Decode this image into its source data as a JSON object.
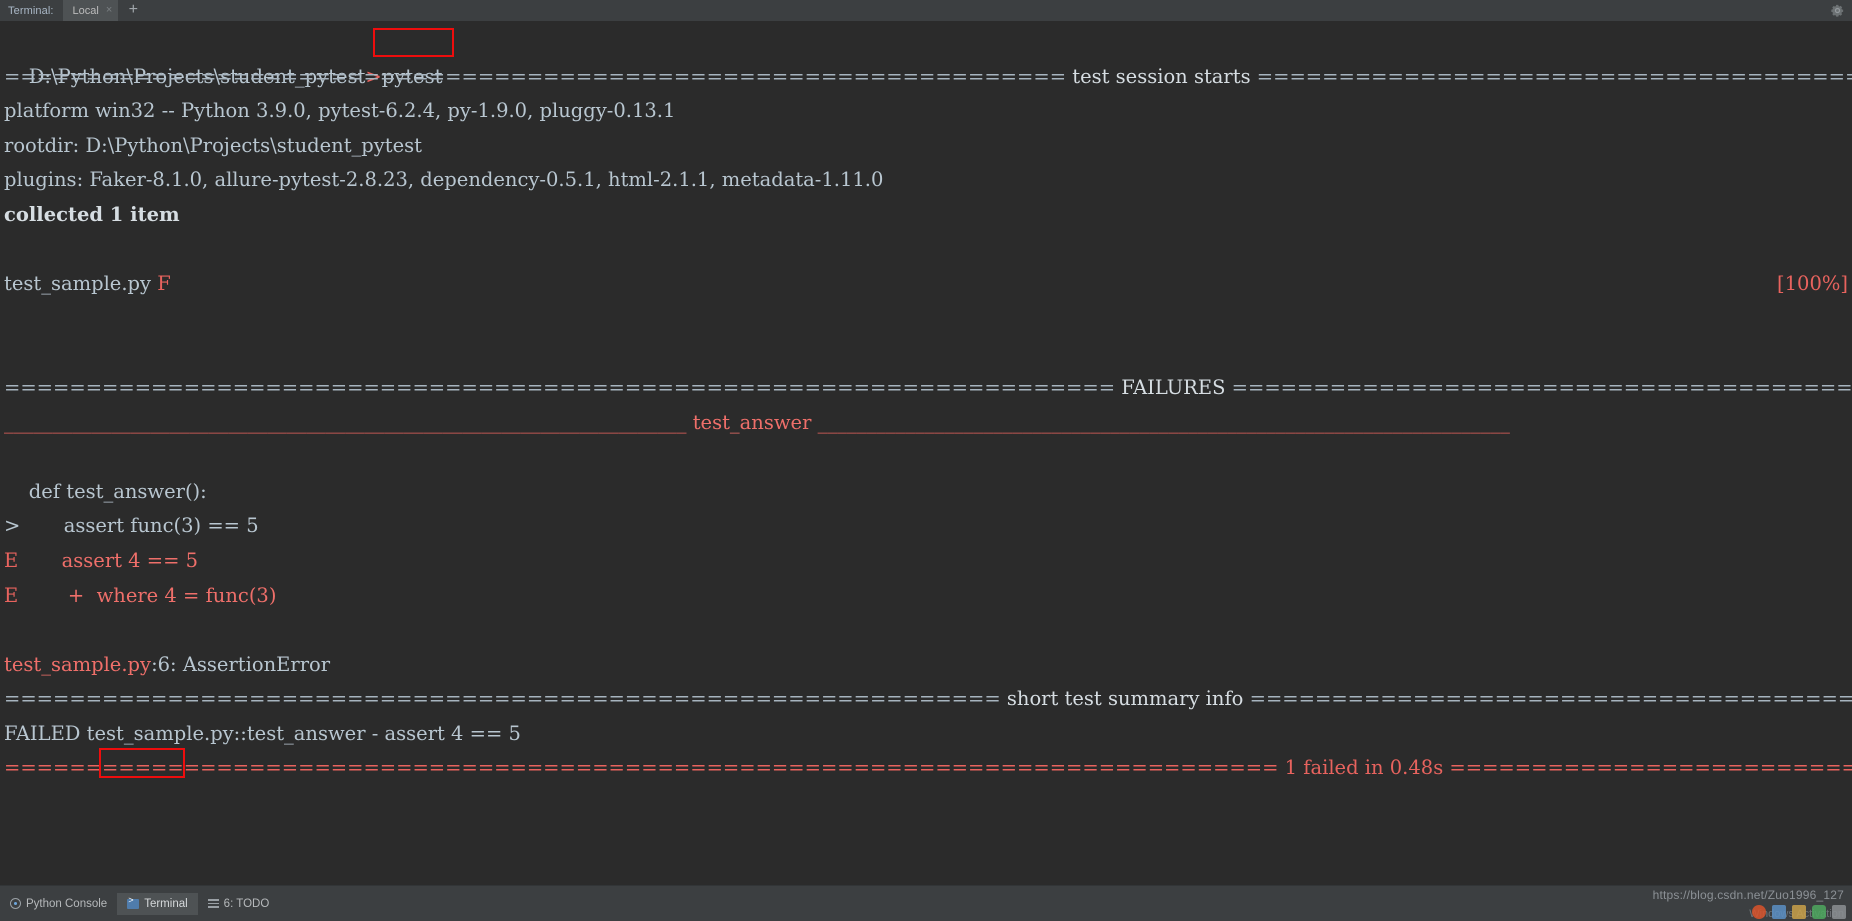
{
  "window": {
    "tab_strip": {
      "label": "Terminal:",
      "tab_name": "Local",
      "tab_close": "×",
      "add_tab": "+",
      "settings_icon": "gear-icon"
    }
  },
  "terminal": {
    "prompt_path": "D:\\Python\\Projects\\student_pytest",
    "prompt_char": ">",
    "command": "pytest",
    "lines": [
      {
        "id": "session-header",
        "segments": [
          {
            "text": "=================================================================",
            "cls": "dim"
          },
          {
            "text": " test session starts ",
            "cls": "white"
          },
          {
            "text": "=========================================================================",
            "cls": "dim"
          }
        ]
      },
      {
        "id": "platform",
        "segments": [
          {
            "text": "platform win32 -- Python 3.9.0, pytest-6.2.4, py-1.9.0, pluggy-0.13.1",
            "cls": "blue"
          }
        ]
      },
      {
        "id": "rootdir",
        "segments": [
          {
            "text": "rootdir: D:\\Python\\Projects\\student_pytest",
            "cls": "blue"
          }
        ]
      },
      {
        "id": "plugins",
        "segments": [
          {
            "text": "plugins: Faker-8.1.0, allure-pytest-2.8.23, dependency-0.5.1, html-2.1.1, metadata-1.11.0",
            "cls": "blue"
          }
        ]
      },
      {
        "id": "collected",
        "bold": true,
        "segments": [
          {
            "text": "collected 1 item",
            "cls": "white"
          }
        ]
      },
      {
        "id": "blank-1",
        "segments": [
          {
            "text": " ",
            "cls": "blue"
          }
        ]
      },
      {
        "id": "test-progress",
        "segments": [
          {
            "text": "test_sample.py ",
            "cls": "blue"
          },
          {
            "text": "F",
            "cls": "red"
          }
        ],
        "right": [
          {
            "text": "[100%]",
            "cls": "red"
          }
        ]
      },
      {
        "id": "blank-2",
        "segments": [
          {
            "text": " ",
            "cls": "blue"
          }
        ]
      },
      {
        "id": "blank-3",
        "segments": [
          {
            "text": " ",
            "cls": "blue"
          }
        ]
      },
      {
        "id": "failures-header",
        "segments": [
          {
            "text": "==================================================================== ",
            "cls": "dim"
          },
          {
            "text": "FAILURES",
            "cls": "white"
          },
          {
            "text": " =====================================================================",
            "cls": "dim"
          }
        ]
      },
      {
        "id": "failure-title",
        "segments": [
          {
            "text": "______________________________________________________________________ ",
            "cls": "red"
          },
          {
            "text": "test_answer",
            "cls": "lightred"
          },
          {
            "text": " _______________________________________________________________________",
            "cls": "red"
          }
        ]
      },
      {
        "id": "blank-4",
        "segments": [
          {
            "text": " ",
            "cls": "blue"
          }
        ]
      },
      {
        "id": "code-def",
        "segments": [
          {
            "text": "    def test_answer():",
            "cls": "blue"
          }
        ]
      },
      {
        "id": "code-assert",
        "segments": [
          {
            "text": ">",
            "cls": "blue"
          },
          {
            "text": "       assert func(3) == 5",
            "cls": "blue"
          }
        ]
      },
      {
        "id": "error-assert",
        "segments": [
          {
            "text": "E",
            "cls": "red"
          },
          {
            "text": "       assert 4 == 5",
            "cls": "lightred"
          }
        ]
      },
      {
        "id": "error-where",
        "segments": [
          {
            "text": "E",
            "cls": "red"
          },
          {
            "text": "        +  where 4 = func(3)",
            "cls": "lightred"
          }
        ]
      },
      {
        "id": "blank-5",
        "segments": [
          {
            "text": " ",
            "cls": "blue"
          }
        ]
      },
      {
        "id": "error-location",
        "segments": [
          {
            "text": "test_sample.py",
            "cls": "lightred"
          },
          {
            "text": ":6: ",
            "cls": "blue"
          },
          {
            "text": "AssertionError",
            "cls": "blue"
          }
        ]
      },
      {
        "id": "summary-header",
        "segments": [
          {
            "text": "============================================================= ",
            "cls": "dim"
          },
          {
            "text": "short test summary info",
            "cls": "white"
          },
          {
            "text": " =============================================================",
            "cls": "dim"
          }
        ]
      },
      {
        "id": "summary-failed",
        "segments": [
          {
            "text": "FAILED test_sample.py::test_answer - assert 4 == 5",
            "cls": "blue"
          }
        ]
      },
      {
        "id": "final-result",
        "segments": [
          {
            "text": "==============================================================================",
            "cls": "red"
          },
          {
            "text": " 1 failed in 0.48s ",
            "cls": "red"
          },
          {
            "text": "===============================================================================",
            "cls": "red"
          }
        ]
      }
    ]
  },
  "status_bar": {
    "items": [
      {
        "label": "Python Console",
        "icon": "python-console-icon",
        "active": false
      },
      {
        "label": "Terminal",
        "icon": "terminal-icon",
        "active": true
      },
      {
        "label": "6: TODO",
        "icon": "todo-list-icon",
        "active": false
      }
    ]
  },
  "watermark": {
    "url": "https://blog.csdn.net/Zuo1996_127",
    "sub": "Windows Activation"
  },
  "annotations": [
    {
      "id": "annot-pytest",
      "target": "pytest-command",
      "color": "#ee0d0d"
    },
    {
      "id": "annot-terminal-tab",
      "target": "terminal-status-tab",
      "color": "#ee0d0d"
    }
  ]
}
